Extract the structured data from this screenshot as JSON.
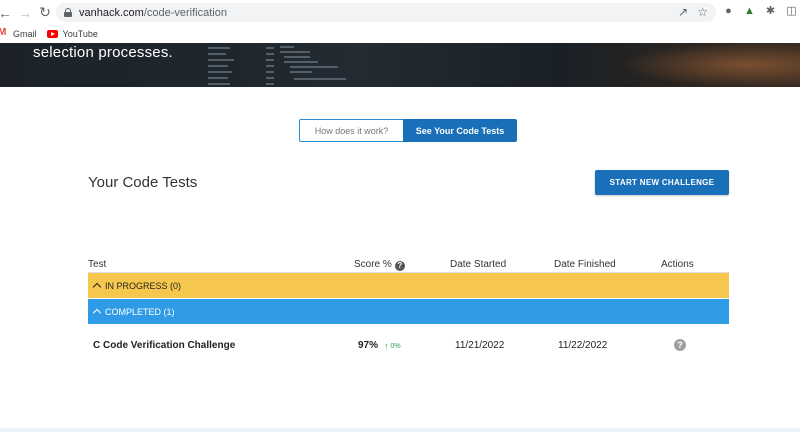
{
  "browser": {
    "url_host": "vanhack.com",
    "url_path": "/code-verification",
    "bookmarks": [
      {
        "label": "Gmail"
      },
      {
        "label": "YouTube"
      }
    ]
  },
  "hero": {
    "text": "selection processes."
  },
  "toggle": {
    "how_label": "How does it work?",
    "tests_label": "See Your Code Tests"
  },
  "main": {
    "title": "Your Code Tests",
    "start_button": "START NEW CHALLENGE"
  },
  "table": {
    "columns": {
      "test": "Test",
      "score": "Score %",
      "date_started": "Date Started",
      "date_finished": "Date Finished",
      "actions": "Actions"
    },
    "groups": {
      "in_progress": "IN PROGRESS (0)",
      "completed": "COMPLETED (1)"
    },
    "rows": [
      {
        "name": "C Code Verification Challenge",
        "score": "97%",
        "change": "0%",
        "date_started": "11/21/2022",
        "date_finished": "11/22/2022"
      }
    ]
  },
  "colors": {
    "primary": "#1a6fb9",
    "in_progress": "#f5c84d",
    "completed": "#2f9be6",
    "trend_up": "#2e9e4f"
  }
}
